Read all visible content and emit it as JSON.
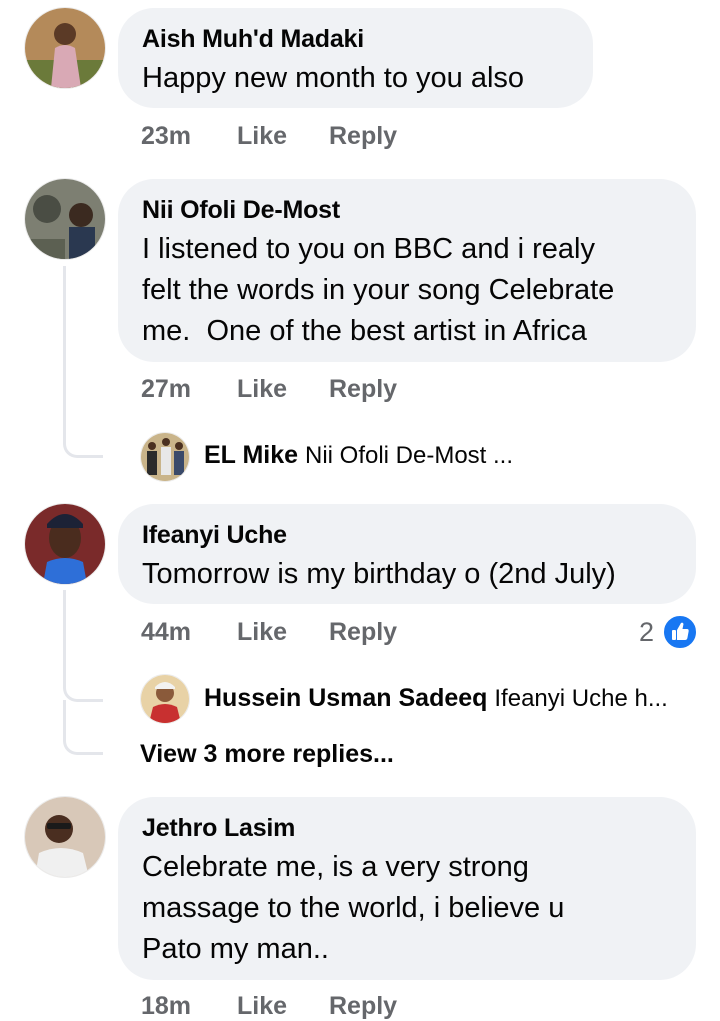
{
  "comments": [
    {
      "author": "Aish Muh'd Madaki",
      "text": "Happy new month to you also",
      "time": "23m",
      "like": "Like",
      "reply": "Reply"
    },
    {
      "author": "Nii Ofoli De-Most",
      "text": "I listened to you on BBC and i realy\nfelt the words in your song Celebrate\nme.  One of the best artist in Africa",
      "time": "27m",
      "like": "Like",
      "reply": "Reply",
      "replies": [
        {
          "author": "EL Mike",
          "snippet": "Nii Ofoli De-Most ..."
        }
      ]
    },
    {
      "author": "Ifeanyi Uche",
      "text": "Tomorrow is my birthday o (2nd July)",
      "time": "44m",
      "like": "Like",
      "reply": "Reply",
      "reaction_count": "2",
      "reaction_icon": "thumbs-up-icon",
      "replies": [
        {
          "author": "Hussein Usman Sadeeq",
          "snippet": "Ifeanyi Uche h..."
        }
      ],
      "view_more": "View 3 more replies..."
    },
    {
      "author": "Jethro Lasim",
      "text": "Celebrate me, is a very strong\nmassage to the world, i believe u\nPato my man..",
      "time": "18m",
      "like": "Like",
      "reply": "Reply"
    }
  ],
  "colors": {
    "bubble": "#f0f2f5",
    "meta_text": "#65676b",
    "like_blue": "#1877f2",
    "thread_line": "#e4e6eb"
  }
}
